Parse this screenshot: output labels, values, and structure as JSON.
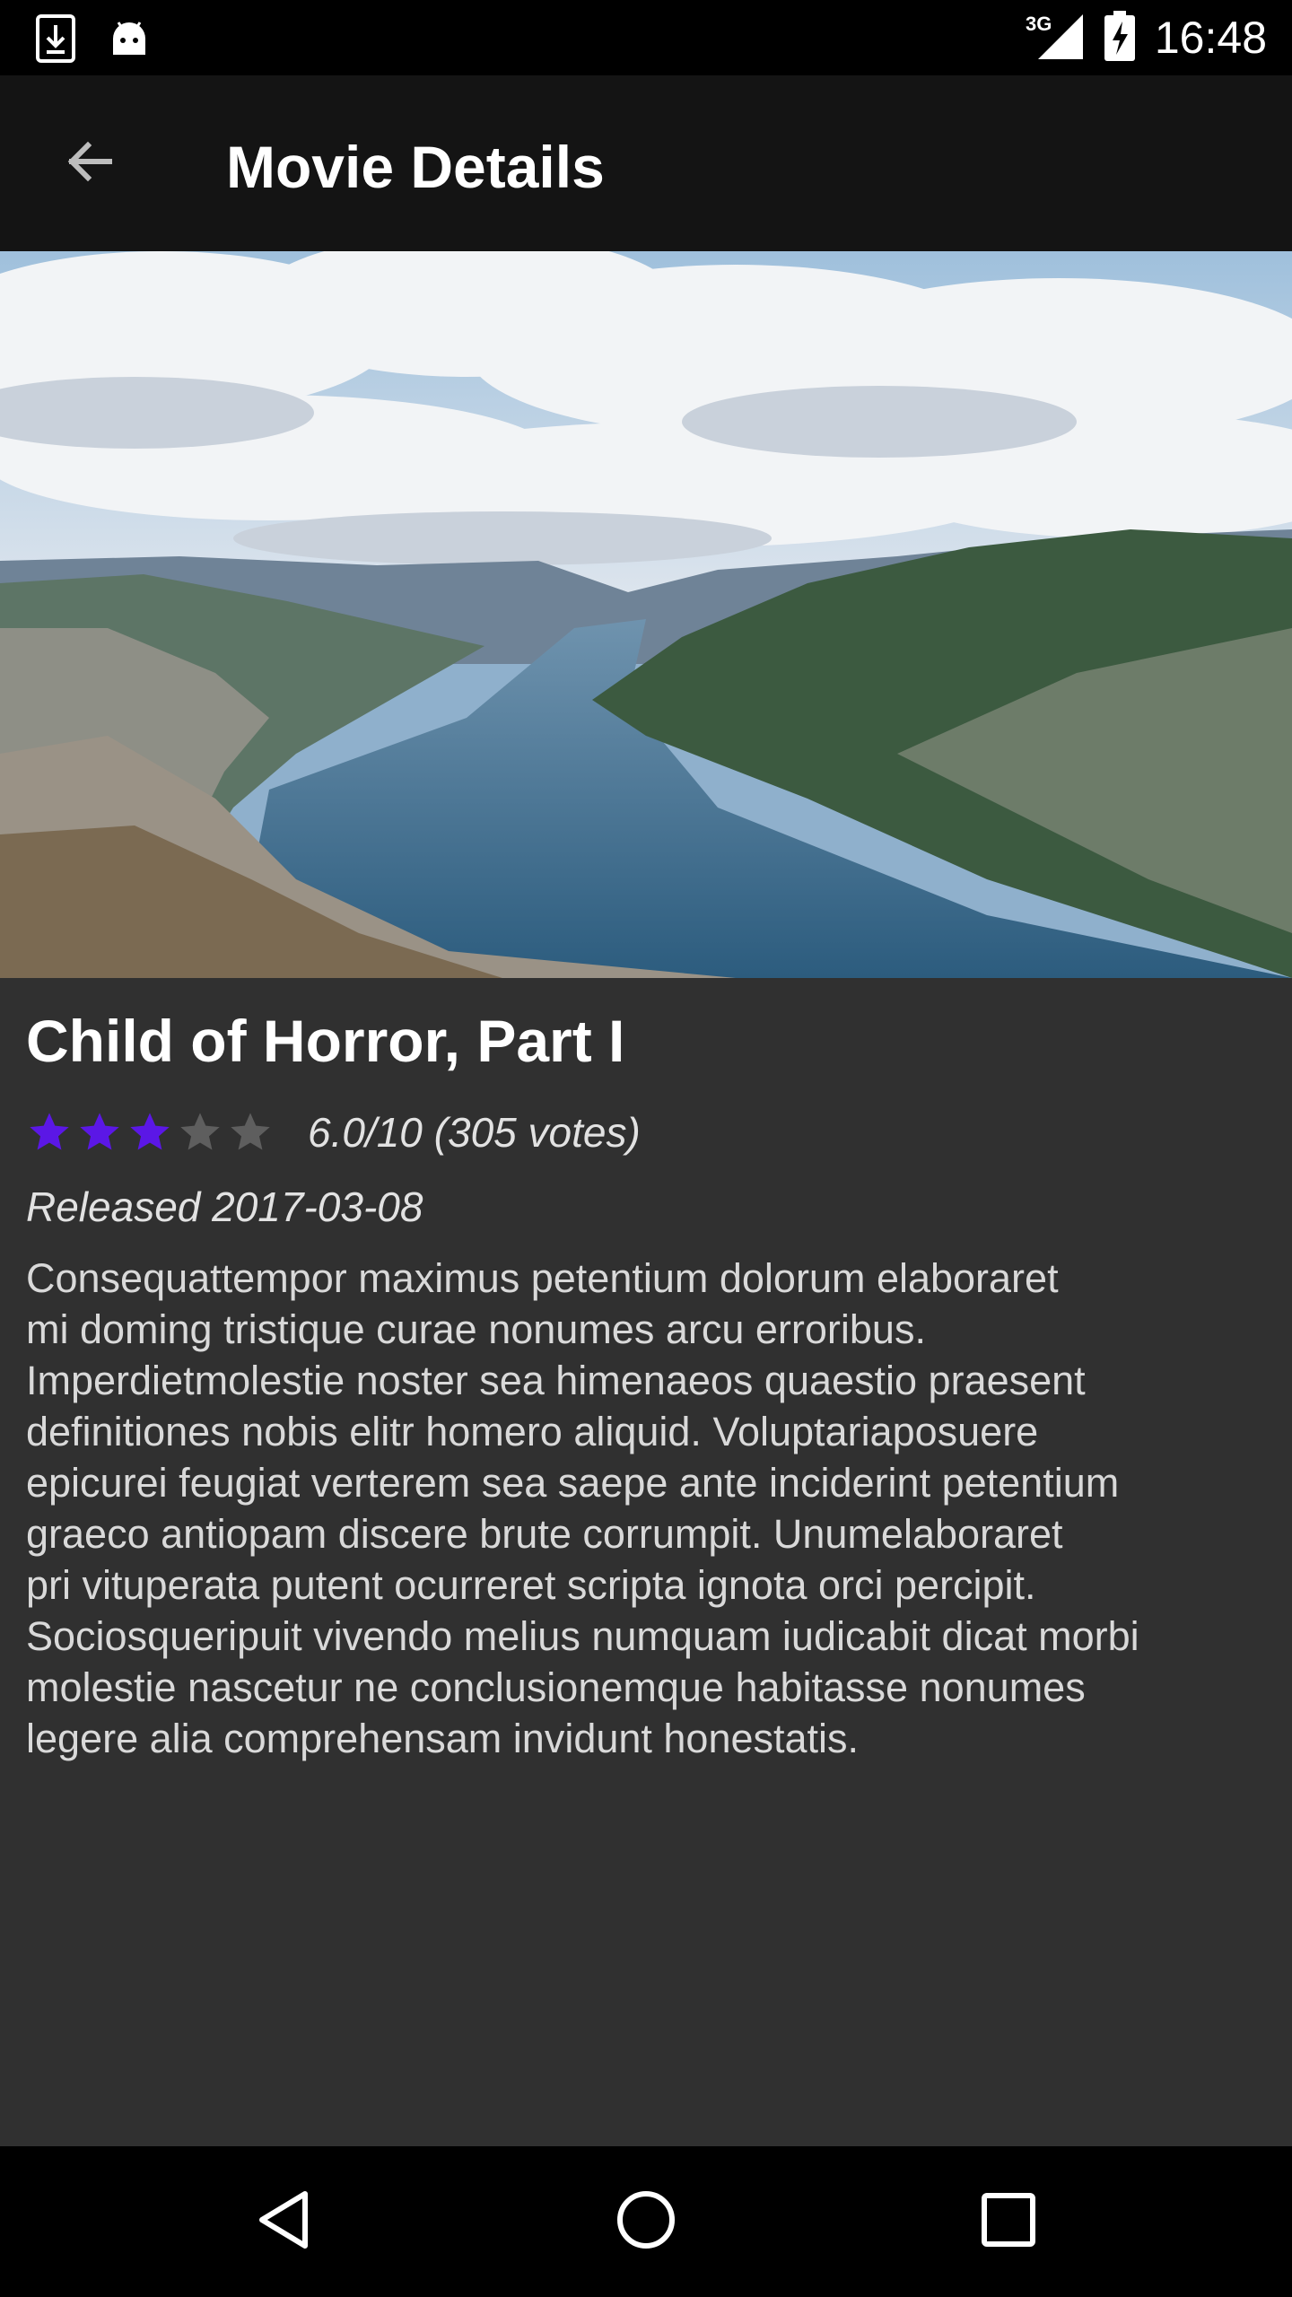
{
  "status_bar": {
    "time": "16:48",
    "network": "3G",
    "icons": [
      "download-icon",
      "android-icon",
      "signal-icon",
      "battery-charging-icon"
    ]
  },
  "app_bar": {
    "title": "Movie Details",
    "back_icon": "arrow-back-icon"
  },
  "movie": {
    "title": "Child of Horror, Part I",
    "rating_stars": 3,
    "rating_max_stars": 5,
    "rating_text": "6.0/10 (305 votes)",
    "release": "Released 2017-03-08",
    "overview_lines": [
      "Consequattempor maximus petentium dolorum elaboraret",
      "mi doming tristique curae nonumes arcu erroribus.",
      "Imperdietmolestie noster sea himenaeos quaestio praesent",
      "definitiones nobis elitr homero aliquid.  Voluptariaposuere",
      "epicurei feugiat verterem sea saepe ante inciderint petentium",
      "graeco antiopam discere brute corrumpit.  Unumelaboraret",
      "pri vituperata putent ocurreret scripta ignota orci percipit.",
      "Sociosqueripuit vivendo melius numquam iudicabit dicat morbi",
      "molestie nascetur ne conclusionemque habitasse nonumes",
      "legere alia comprehensam invidunt honestatis."
    ]
  },
  "colors": {
    "star_filled": "#5b17e6",
    "star_empty": "#5e5e5e",
    "background": "#303030",
    "app_bar": "#141414"
  },
  "nav_bar": {
    "icons": [
      "nav-back-icon",
      "nav-home-icon",
      "nav-recents-icon"
    ]
  }
}
